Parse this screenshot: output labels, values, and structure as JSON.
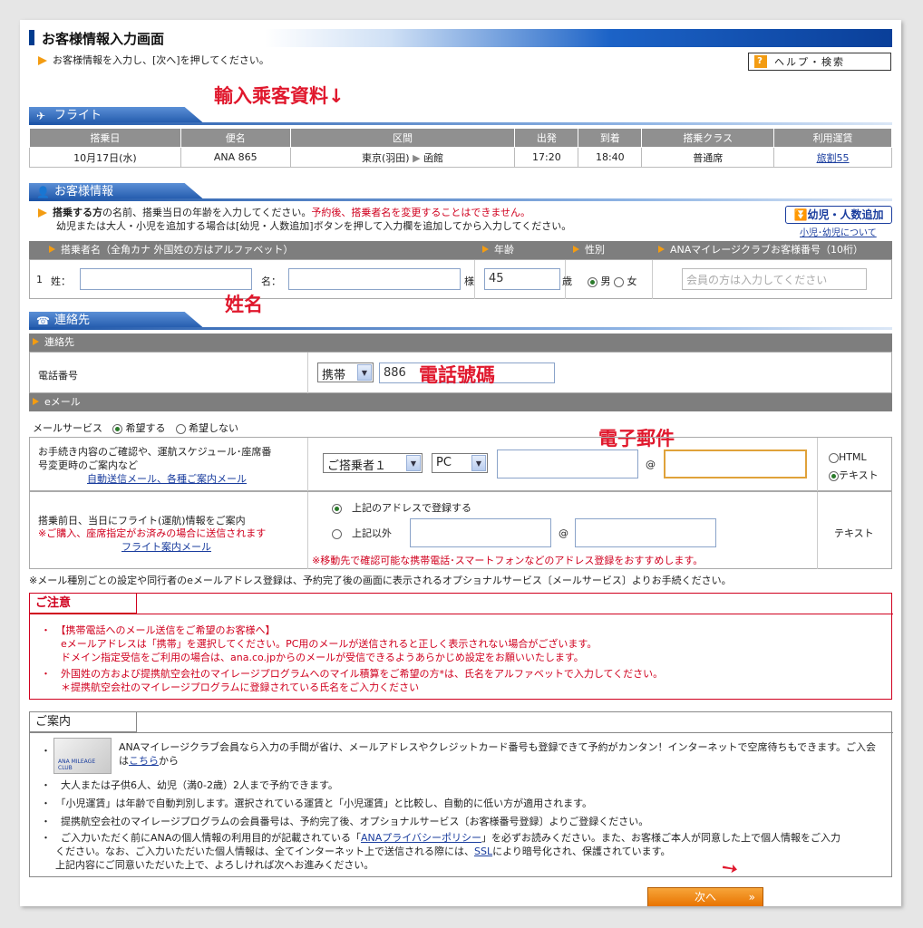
{
  "header": {
    "title": "お客様情報入力画面",
    "instruction": "お客様情報を入力し、[次へ]を押してください。",
    "help_label": "ヘルプ・検索"
  },
  "annotations": {
    "input_passenger": "輸入乘客資料↓",
    "name": "姓名",
    "phone": "電話號碼",
    "email": "電子郵件"
  },
  "flight": {
    "section_title": "フライト",
    "columns": [
      "搭乗日",
      "便名",
      "区間",
      "出発",
      "到着",
      "搭乗クラス",
      "利用運賃"
    ],
    "row": {
      "date": "10月17日(水)",
      "flight_no": "ANA 865",
      "from": "東京(羽田)",
      "to": "函館",
      "dep": "17:20",
      "arr": "18:40",
      "class": "普通席",
      "fare": "旅割55"
    }
  },
  "customer": {
    "section_title": "お客様情報",
    "notice_bold": "搭乗する方",
    "notice_text": "の名前、搭乗当日の年齢を入力してください。",
    "notice_red": "予約後、搭乗者名を変更することはできません。",
    "notice2": "幼児または大人・小児を追加する場合は[幼児・人数追加]ボタンを押して入力欄を追加してから入力してください。",
    "add_button": "幼児・人数追加",
    "add_link": "小児･幼児について",
    "cols": {
      "name": "搭乗者名（全角カナ 外国姓の方はアルファベット）",
      "age": "年齢",
      "sex": "性別",
      "mileage": "ANAマイレージクラブお客様番号（10桁）"
    },
    "row": {
      "num": "1",
      "last_label": "姓：",
      "last_value": "",
      "first_label": "名：",
      "first_value": "",
      "sama": "様",
      "age_value": "45",
      "sai": "歳",
      "male": "男",
      "female": "女",
      "mileage_placeholder": "会員の方は入力してください"
    }
  },
  "contact": {
    "section_title": "連絡先",
    "bar_label": "連絡先",
    "phone_label": "電話番号",
    "phone_type": "携帯",
    "phone_value": "886",
    "email_bar": "eメール",
    "mail_service_label": "メールサービス",
    "mail_want": "希望する",
    "mail_notwant": "希望しない",
    "confirm_text1": "お手続き内容のご確認や、運航スケジュール･座席番",
    "confirm_text2": "号変更時のご案内など",
    "confirm_link": "自動送信メール、各種ご案内メール",
    "passenger_select": "ご搭乗者１",
    "device_select": "PC",
    "email_local": "",
    "at": "@",
    "email_domain": "",
    "fmt_html": "HTML",
    "fmt_text": "テキスト",
    "flight_info1": "搭乗前日、当日にフライト(運航)情報をご案内",
    "flight_info2": "※ご購入、座席指定がお済みの場合に送信されます",
    "flight_info_link": "フライト案内メール",
    "opt_same": "上記のアドレスで登録する",
    "opt_other": "上記以外",
    "fmt_text2": "テキスト",
    "mobile_note": "※移動先で確認可能な携帯電話･スマートフォンなどのアドレス登録をおすすめします。",
    "footnote": "※メール種別ごとの設定や同行者のeメールアドレス登録は、予約完了後の画面に表示されるオプショナルサービス〔メールサービス〕よりお手続ください。"
  },
  "caution": {
    "title": "ご注意",
    "lines": [
      "・　【携帯電話へのメール送信をご希望のお客様へ】",
      "　　eメールアドレスは「携帯」を選択してください。PC用のメールが送信されると正しく表示されない場合がございます。",
      "　　ドメイン指定受信をご利用の場合は、ana.co.jpからのメールが受信できるようあらかじめ設定をお願いいたします。",
      "・　外国姓の方および提携航空会社のマイレージプログラムへのマイル積算をご希望の方*は、氏名をアルファベットで入力してください。",
      "　　＊提携航空会社のマイレージプログラムに登録されている氏名をご入力ください"
    ]
  },
  "info": {
    "title": "ご案内",
    "card_label": "ANA MILEAGE CLUB",
    "amc_line1": "ANAマイレージクラブ会員なら入力の手間が省け、メールアドレスやクレジットカード番号も登録できて予約がカンタン！インターネットで空席待ちもできます。ご入会",
    "amc_line2a": "は",
    "amc_link": "こちら",
    "amc_line2b": "から",
    "bullet2": "大人または子供6人、幼児（満0-2歳）2人まで予約できます。",
    "bullet3": "「小児運賃」は年齢で自動判別します。選択されている運賃と「小児運賃」と比較し、自動的に低い方が適用されます。",
    "bullet4": "提携航空会社のマイレージプログラムの会員番号は、予約完了後、オプショナルサービス〔お客様番号登録〕よりご登録ください。",
    "bullet5a": "ご入力いただく前にANAの個人情報の利用目的が記載されている「",
    "privacy_link": "ANAプライバシーポリシー",
    "bullet5b": "」を必ずお読みください。また、お客様ご本人が同意した上で個人情報をご入力",
    "bullet5c": "ください。なお、ご入力いただいた個人情報は、全てインターネット上で送信される際には、",
    "ssl_link": "SSL",
    "bullet5d": "により暗号化され、保護されています。",
    "bullet5e": "上記内容にご同意いただいた上で、よろしければ次へお進みください。"
  },
  "next_button": "次へ"
}
